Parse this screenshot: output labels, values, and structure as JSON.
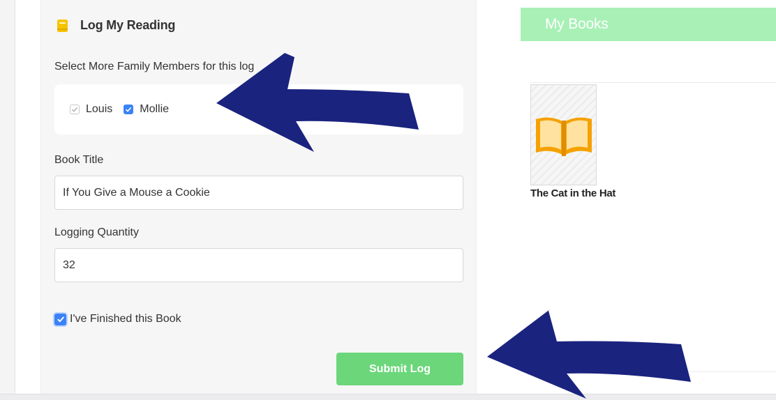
{
  "log_panel": {
    "title": "Log My Reading",
    "icon": "book-icon",
    "family_label": "Select More Family Members for this log",
    "family_members": [
      {
        "name": "Louis",
        "checked": true,
        "disabled": true
      },
      {
        "name": "Mollie",
        "checked": true,
        "disabled": false
      }
    ],
    "book_title_label": "Book Title",
    "book_title_value": "If You Give a Mouse a Cookie",
    "quantity_label": "Logging Quantity",
    "quantity_value": "32",
    "finished_label": "I've Finished this Book",
    "finished_checked": true,
    "submit_label": "Submit Log"
  },
  "books_panel": {
    "title": "My Books",
    "books": [
      {
        "title": "The Cat in the Hat",
        "icon": "open-book-icon"
      }
    ]
  },
  "colors": {
    "accent_blue": "#3b82f6",
    "submit_green": "#6bd67a",
    "books_header_green": "#a8f0b6",
    "book_icon_orange": "#f5a100",
    "arrow_navy": "#1a237e"
  }
}
